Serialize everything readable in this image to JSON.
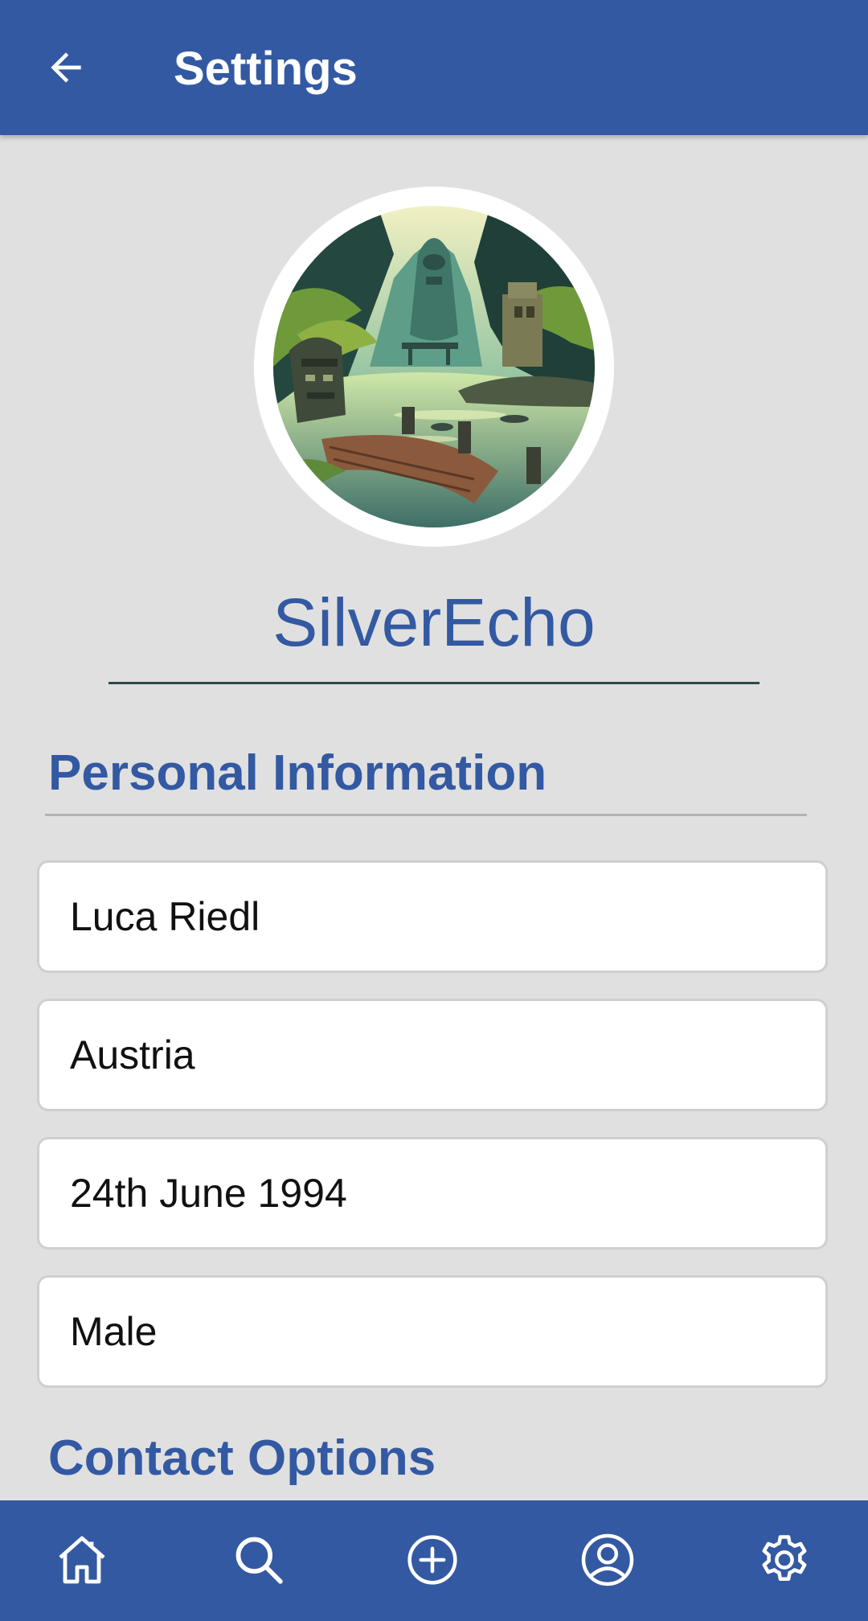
{
  "app_bar": {
    "title": "Settings",
    "back_icon": "arrow-left-icon"
  },
  "profile": {
    "username": "SilverEcho",
    "avatar_description": "jungle lagoon with tiki statues and wooden dock"
  },
  "personal_information": {
    "title": "Personal Information",
    "fields": [
      {
        "name": "full-name",
        "value": "Luca Riedl"
      },
      {
        "name": "country",
        "value": "Austria"
      },
      {
        "name": "birth-date",
        "value": "24th June 1994"
      },
      {
        "name": "gender",
        "value": "Male"
      }
    ]
  },
  "contact_options": {
    "title": "Contact Options"
  },
  "bottom_nav": {
    "items": [
      {
        "icon": "home-icon"
      },
      {
        "icon": "search-icon"
      },
      {
        "icon": "add-circle-icon"
      },
      {
        "icon": "profile-icon"
      },
      {
        "icon": "gear-icon"
      }
    ]
  },
  "colors": {
    "primary": "#3359a2",
    "background": "#e0e0e0",
    "field_background": "#ffffff",
    "field_border": "#cfcfcf",
    "underline": "#2c4a4a"
  }
}
